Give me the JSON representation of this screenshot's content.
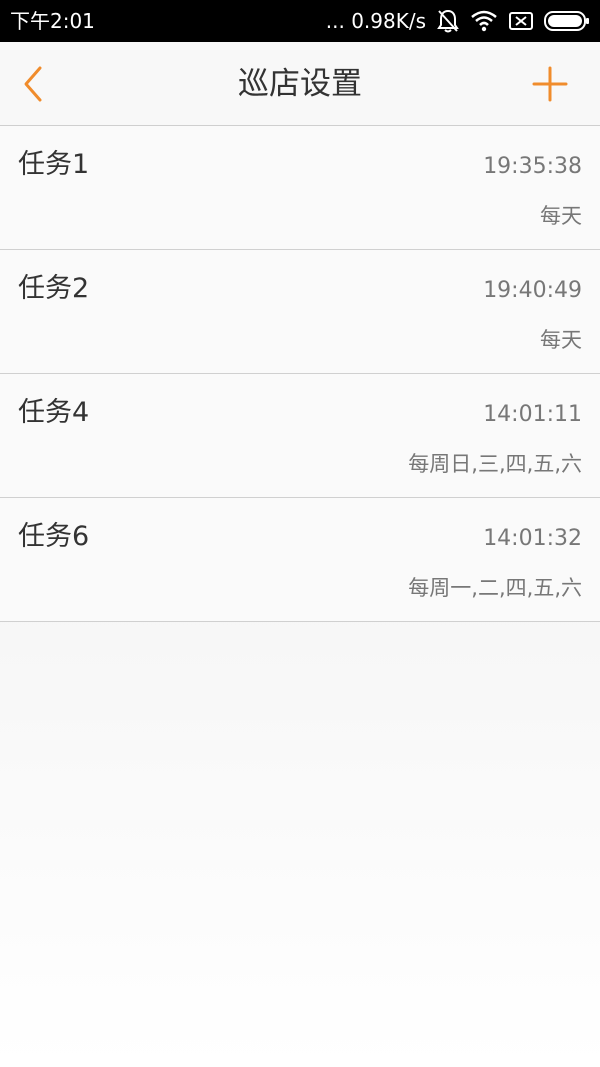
{
  "status_bar": {
    "time": "下午2:01",
    "network_speed": "... 0.98K/s",
    "icons": [
      "mute-bell-icon",
      "wifi-icon",
      "sim-card-icon",
      "battery-icon"
    ]
  },
  "header": {
    "title": "巡店设置",
    "back_icon": "chevron-left-icon",
    "add_icon": "plus-icon"
  },
  "colors": {
    "accent": "#f08c2c",
    "status_bar_bg": "#000000",
    "text_primary": "#333333",
    "text_secondary": "#777777"
  },
  "tasks": [
    {
      "name": "任务1",
      "time": "19:35:38",
      "repeat": "每天"
    },
    {
      "name": "任务2",
      "time": "19:40:49",
      "repeat": "每天"
    },
    {
      "name": "任务4",
      "time": "14:01:11",
      "repeat": "每周日,三,四,五,六"
    },
    {
      "name": "任务6",
      "time": "14:01:32",
      "repeat": "每周一,二,四,五,六"
    }
  ]
}
